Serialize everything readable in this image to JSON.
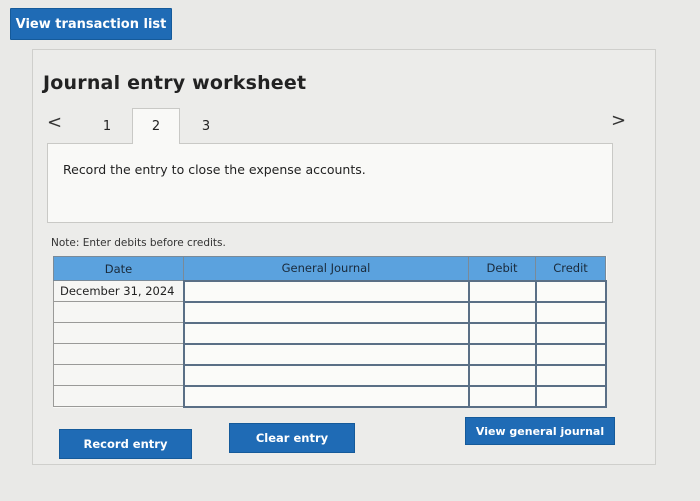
{
  "top_button": {
    "label": "View transaction list"
  },
  "worksheet": {
    "title": "Journal entry worksheet",
    "nav": {
      "prev": "<",
      "next": ">"
    },
    "tabs": [
      {
        "label": "1"
      },
      {
        "label": "2"
      },
      {
        "label": "3"
      }
    ],
    "active_tab": "2",
    "instruction": "Record the entry to close the expense accounts.",
    "note": "Note: Enter debits before credits.",
    "table": {
      "headers": {
        "date": "Date",
        "general_journal": "General Journal",
        "debit": "Debit",
        "credit": "Credit"
      },
      "rows": [
        {
          "date": "December 31, 2024",
          "account": "",
          "debit": "",
          "credit": ""
        },
        {
          "date": "",
          "account": "",
          "debit": "",
          "credit": ""
        },
        {
          "date": "",
          "account": "",
          "debit": "",
          "credit": ""
        },
        {
          "date": "",
          "account": "",
          "debit": "",
          "credit": ""
        },
        {
          "date": "",
          "account": "",
          "debit": "",
          "credit": ""
        },
        {
          "date": "",
          "account": "",
          "debit": "",
          "credit": ""
        }
      ]
    },
    "buttons": {
      "record": "Record entry",
      "clear": "Clear entry",
      "view_journal": "View general journal"
    }
  },
  "colors": {
    "button_blue": "#1f6bb5",
    "header_blue": "#5ba2de",
    "background": "#e9e9e7"
  }
}
